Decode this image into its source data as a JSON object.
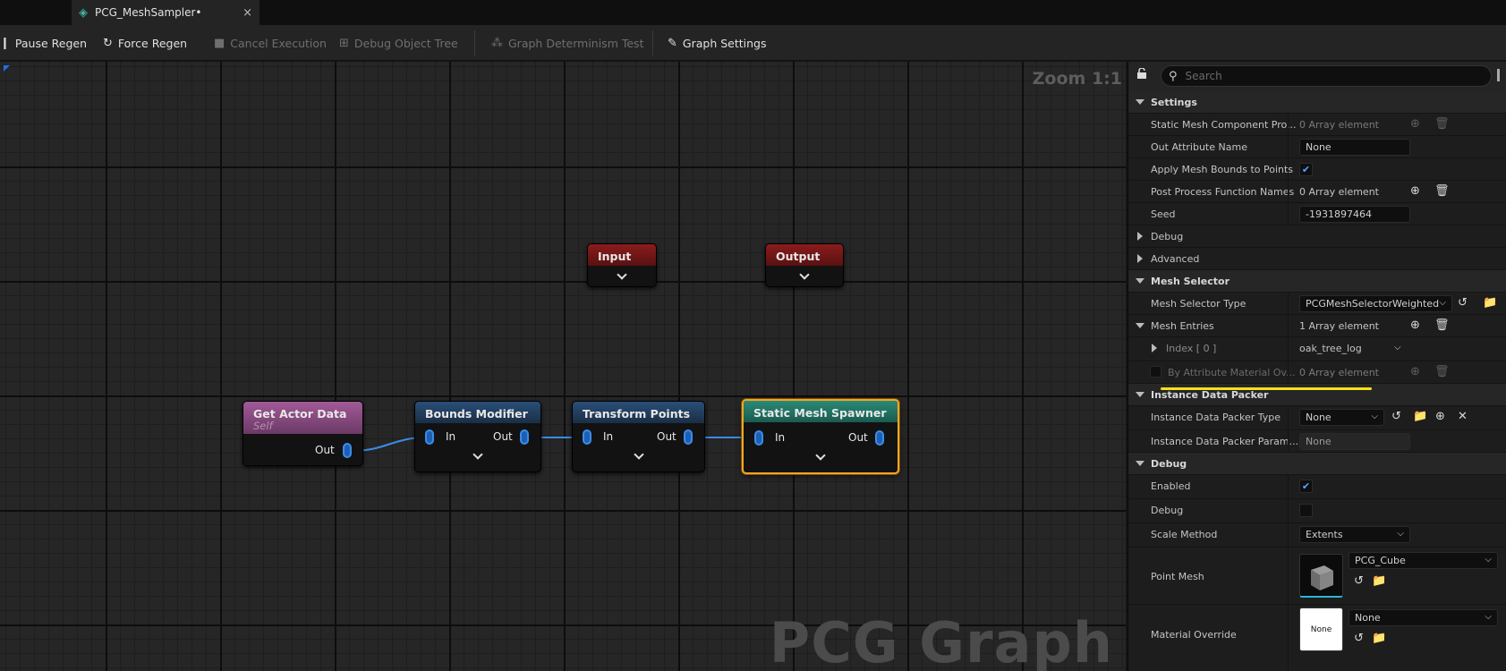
{
  "tab": {
    "title": "PCG_MeshSampler•",
    "close": "×"
  },
  "toolbar": {
    "pause_regen": "Pause Regen",
    "force_regen": "Force Regen",
    "cancel_execution": "Cancel Execution",
    "debug_object_tree": "Debug Object Tree",
    "graph_determinism_test": "Graph Determinism Test",
    "graph_settings": "Graph Settings"
  },
  "graph": {
    "zoom": "Zoom 1:1",
    "watermark": "PCG Graph",
    "nodes": {
      "input": {
        "title": "Input"
      },
      "output": {
        "title": "Output"
      },
      "get_actor_data": {
        "title": "Get Actor Data",
        "subtitle": "Self",
        "out": "Out"
      },
      "bounds_modifier": {
        "title": "Bounds Modifier",
        "in": "In",
        "out": "Out"
      },
      "transform_points": {
        "title": "Transform Points",
        "in": "In",
        "out": "Out"
      },
      "static_mesh_spawner": {
        "title": "Static Mesh Spawner",
        "in": "In",
        "out": "Out"
      }
    }
  },
  "details": {
    "search_placeholder": "Search",
    "settings": {
      "header": "Settings",
      "static_mesh_component": {
        "label": "Static Mesh Component Pro...",
        "value": "0 Array element"
      },
      "out_attribute_name": {
        "label": "Out Attribute Name",
        "value": "None"
      },
      "apply_mesh_bounds": {
        "label": "Apply Mesh Bounds to Points",
        "checked": true
      },
      "post_process": {
        "label": "Post Process Function Names",
        "value": "0 Array element"
      },
      "seed": {
        "label": "Seed",
        "value": "-1931897464"
      },
      "debug": "Debug",
      "advanced": "Advanced"
    },
    "mesh_selector": {
      "header": "Mesh Selector",
      "type": {
        "label": "Mesh Selector Type",
        "value": "PCGMeshSelectorWeighted"
      },
      "entries": {
        "label": "Mesh Entries",
        "value": "1 Array element"
      },
      "index0": {
        "label": "Index [ 0 ]",
        "value": "oak_tree_log"
      },
      "by_attribute": {
        "label": "By Attribute Material Ov...",
        "value": "0 Array element"
      }
    },
    "instance_data_packer": {
      "header": "Instance Data Packer",
      "type": {
        "label": "Instance Data Packer Type",
        "value": "None"
      },
      "params": {
        "label": "Instance Data Packer Param...",
        "value": "None"
      }
    },
    "debug": {
      "header": "Debug",
      "enabled": {
        "label": "Enabled",
        "checked": true
      },
      "debug": {
        "label": "Debug",
        "checked": false
      },
      "scale_method": {
        "label": "Scale Method",
        "value": "Extents"
      },
      "point_mesh": {
        "label": "Point Mesh",
        "value": "PCG_Cube"
      },
      "material_override": {
        "label": "Material Override",
        "value": "None",
        "thumb": "None"
      }
    }
  },
  "colors": {
    "selected_outline": "#f5a623",
    "pin_blue": "#3c8ce8",
    "highlight": "#f5e018"
  }
}
